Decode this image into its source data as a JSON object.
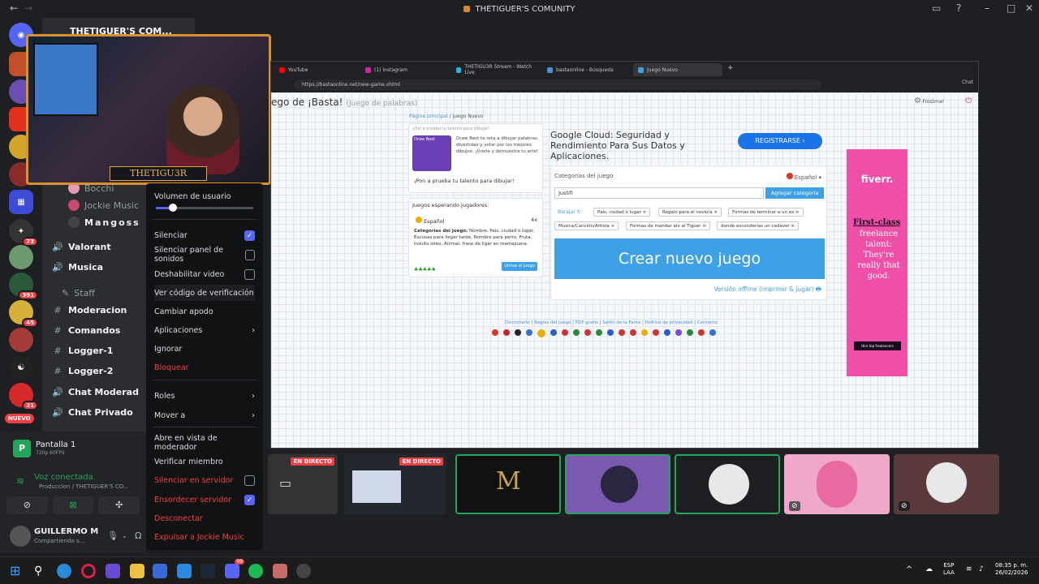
{
  "window": {
    "title": "THETIGUER'S COMUNITY"
  },
  "camera": {
    "server_title": "THETIGUER'S COM...",
    "name_tag": "THETIGU3R"
  },
  "members": {
    "bocchi": "Bocchi",
    "jockie": "Jockie Music",
    "mangoss": "Mangoss"
  },
  "channels": [
    {
      "label": "Valorant",
      "icon": "speaker-icon"
    },
    {
      "label": "Musica",
      "icon": "speaker-icon"
    },
    {
      "label": "Staff",
      "icon": "folder-icon"
    },
    {
      "label": "Moderacion",
      "icon": "hash-icon"
    },
    {
      "label": "Comandos",
      "icon": "hash-icon"
    },
    {
      "label": "Logger-1",
      "icon": "hash-icon"
    },
    {
      "label": "Logger-2",
      "icon": "hash-icon"
    },
    {
      "label": "Chat Moderad",
      "icon": "speaker-icon"
    },
    {
      "label": "Chat Privado",
      "icon": "speaker-icon"
    }
  ],
  "server_badges": [
    "73",
    "391",
    "45",
    "21"
  ],
  "new_badge": "NUEVO",
  "menu": {
    "volume_label": "Volumen de usuario",
    "items": [
      "Silenciar",
      "Silenciar panel de sonidos",
      "Deshabilitar video",
      "Ver código de verificación",
      "Cambiar apodo",
      "Aplicaciones",
      "Ignorar",
      "Bloquear",
      "Roles",
      "Mover a",
      "Abre en vista de moderador",
      "Verificar miembro",
      "Silenciar en servidor",
      "Ensordecer servidor",
      "Desconectar",
      "Expulsar a Jockie Music"
    ]
  },
  "voice": {
    "screen_title": "Pantalla 1",
    "screen_quality": "720p 60FPS",
    "status": "Voz conectada",
    "channel": "Produccion / THETIGUER'S CO...",
    "user_name": "GUILLERMO M",
    "user_status": "Compartiendo s..."
  },
  "browser": {
    "tabs": [
      "YouTube",
      "(1) Instagram",
      "THETIGU3R Stream - Watch Live",
      "bastaonline - Búsqueda",
      "Juego Nuevo"
    ],
    "url": "https://bastaonline.net/new-game.xhtml",
    "chat_label": "Chat",
    "page": {
      "heading": "ego de ¡Basta!",
      "subheading": "(Juego de palabras)",
      "breadcrumb": [
        "Página principal",
        "Juego Nuevo"
      ],
      "user": "Frostmar",
      "promo_header": "¡Pon a prueba tu talento para dibujar!",
      "promo_app": "Draw Best",
      "promo_text": "Draw Best te reta a dibujar palabras divertidas y votar por los mejores dibujos. ¡Únete y demuestra tu arte!",
      "promo_link": "¡Pon a prueba tu talento para dibujar!",
      "ad_title": "Google Cloud: Seguridad y Rendimiento Para Sus Datos y Aplicaciones.",
      "ad_button": "REGISTRARSE",
      "waiting_title": "Juegos esperando jugadores:",
      "waiting_lang": "Español",
      "waiting_count": "4x",
      "waiting_cats_label": "Categorías del juego:",
      "waiting_cats": "Nombre, País, ciudad o lugar, Excusas para llegar tarde, Nombre para perro, Fruta, Insulto loleo, Animal, frase de ligar en mamajuana",
      "join_button": "Unirse al juego",
      "categories_title": "Categorías del juego",
      "language": "Español",
      "input_value": "Justifi",
      "add_button": "Agregar categoría",
      "shuffle_label": "Barajar",
      "chips": [
        "País, ciudad o lugar",
        "Regalo para el novio/a",
        "Formas de terminar a un ex",
        "Musica/Canción/Artista",
        "Formas de mandar alv al Tiguer",
        "donde esconderías un cadaver"
      ],
      "create_button": "Crear nuevo juego",
      "offline_link": "Versión offline (imprimir & jugar)",
      "footer_links": "Diccionario | Reglas del juego | PDF gratis | Salón de la Fama | Política de privacidad | Contacto",
      "side_ad_brand": "fiverr.",
      "side_ad_bold": "First-class",
      "side_ad_text": "freelance talent: They're really that good.",
      "side_ad_button": "Hire top freelancers"
    }
  },
  "stream_tiles": {
    "live_label": "EN DIRECTO"
  },
  "taskbar": {
    "lang": "ESP",
    "layout": "LAA",
    "time": "08:35 p. m.",
    "date": "26/02/2026",
    "discord_badge": "99"
  },
  "colors": {
    "accent": "#5865f2",
    "danger": "#f23f43",
    "create_button": "#3ea0e6",
    "ad_button": "#1a73e8",
    "fiverr_pink": "#ef4fa6"
  }
}
